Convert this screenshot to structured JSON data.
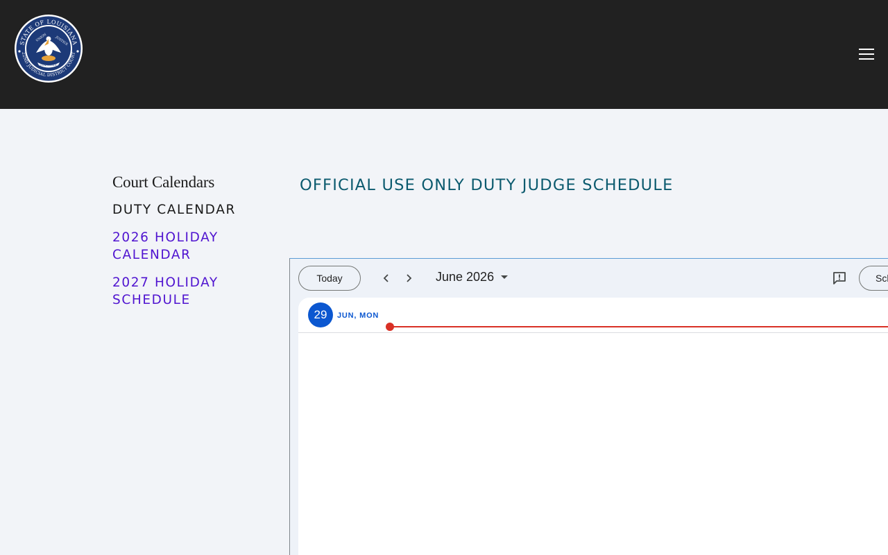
{
  "header": {
    "logo_icon": "louisiana-state-seal",
    "seal_top_text": "STATE OF LOUISIANA",
    "seal_bottom_text": "22ND JUDICIAL DISTRICT COURT",
    "seal_inner_left": "UNION",
    "seal_inner_right": "JUSTICE",
    "seal_banner": "CONFIDENCE",
    "menu_icon": "hamburger-menu-icon",
    "background_color": "#212121"
  },
  "sidebar": {
    "heading": "Court Calendars",
    "items": [
      {
        "label": "Duty Calendar",
        "active": true
      },
      {
        "label": "2026 Holiday Calendar",
        "active": false
      },
      {
        "label": "2027 Holiday Schedule",
        "active": false
      }
    ],
    "link_color": "#5014d0"
  },
  "main": {
    "title": "Official Use Only Duty Judge Schedule",
    "title_color": "#0b5a6e"
  },
  "calendar": {
    "today_label": "Today",
    "prev_icon": "chevron-left-icon",
    "next_icon": "chevron-right-icon",
    "month_label": "June 2026",
    "month_dropdown_icon": "caret-down-icon",
    "feedback_icon": "feedback-icon",
    "view_label": "Schedule",
    "day_number": "29",
    "day_label": "JUN, MON",
    "accent_color": "#0b57d0",
    "now_indicator_color": "#d93025"
  }
}
